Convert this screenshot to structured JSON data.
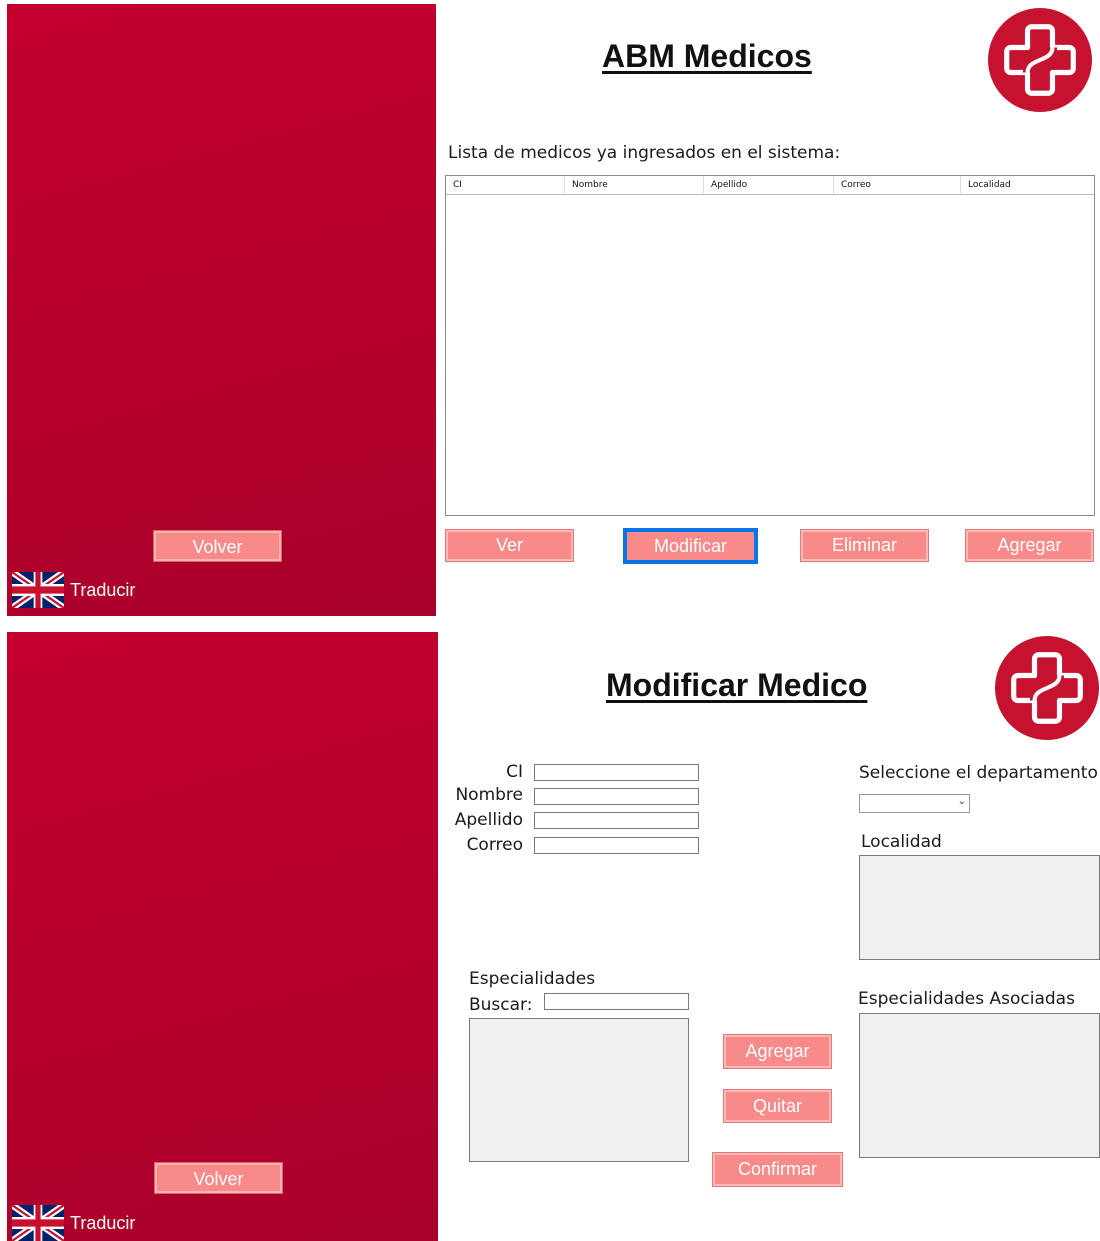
{
  "panel1": {
    "title": "ABM Medicos",
    "list_label": "Lista de medicos  ya ingresados en el sistema:",
    "columns": [
      "CI",
      "Nombre",
      "Apellido",
      "Correo",
      "Localidad"
    ],
    "rows": [],
    "buttons": {
      "ver": "Ver",
      "modificar": "Modificar",
      "eliminar": "Eliminar",
      "agregar": "Agregar"
    },
    "sidebar": {
      "back": "Volver",
      "translate": "Traducir"
    }
  },
  "panel2": {
    "title": "Modificar Medico",
    "fields": {
      "ci": {
        "label": "CI",
        "value": ""
      },
      "nombre": {
        "label": "Nombre",
        "value": ""
      },
      "apellido": {
        "label": "Apellido",
        "value": ""
      },
      "correo": {
        "label": "Correo",
        "value": ""
      }
    },
    "departamento": {
      "label": "Seleccione el departamento",
      "selected": ""
    },
    "localidad_label": "Localidad",
    "especialidades": {
      "label": "Especialidades",
      "search_label": "Buscar:",
      "search_value": ""
    },
    "asociadas_label": "Especialidades Asociadas",
    "buttons": {
      "agregar": "Agregar",
      "quitar": "Quitar",
      "confirmar": "Confirmar"
    },
    "sidebar": {
      "back": "Volver",
      "translate": "Traducir"
    }
  },
  "colors": {
    "brand_red": "#b8002c",
    "button_pink": "#f88a8a",
    "focus_blue": "#0a73e8"
  },
  "icons": [
    "uk-flag-icon",
    "medical-cross-logo"
  ]
}
